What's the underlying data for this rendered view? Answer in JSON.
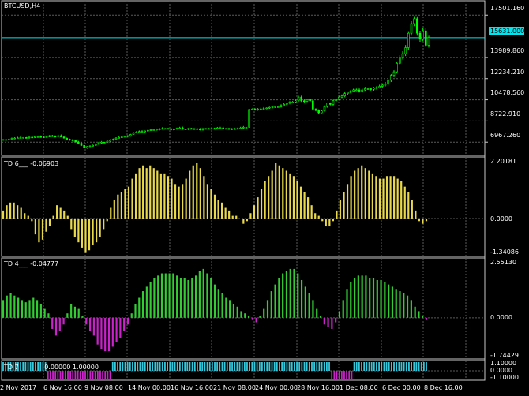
{
  "symbol_title": "BTCUSD,H4",
  "current_price": "15631.000",
  "price_axis": [
    "17501.160",
    "15631.000",
    "13989.860",
    "12234.210",
    "10478.560",
    "8722.910",
    "6967.260"
  ],
  "panels": [
    {
      "name": "TD 6",
      "value": "-0.06903",
      "axis": [
        "2.20181",
        "0.0000",
        "-1.34086"
      ]
    },
    {
      "name": "TD 4",
      "value": "-0.04777",
      "axis": [
        "2.55130",
        "0.0000",
        "-1.74429"
      ]
    },
    {
      "name": "TD 7",
      "values": "0.00000 1.00000",
      "axis": [
        "1.10000",
        "0.0000",
        "-1.10000"
      ]
    }
  ],
  "time_axis": [
    "2 Nov 2017",
    "6 Nov 16:00",
    "9 Nov 08:00",
    "14 Nov 00:00",
    "16 Nov 16:00",
    "21 Nov 08:00",
    "24 Nov 00:00",
    "28 Nov 16:00",
    "1 Dec 08:00",
    "6 Dec 00:00",
    "8 Dec 16:00"
  ],
  "colors": {
    "background": "#000000",
    "grid": "#5a5a5a",
    "bull": "#00ff00",
    "bear": "#00ff00",
    "price_line": "#00e5ee",
    "hist_yellow": "#e8d84a",
    "hist_green": "#33cc33",
    "hist_magenta": "#cc22cc",
    "td7_cyan": "#33c8dc",
    "td7_magenta": "#cc22cc"
  },
  "chart_data": {
    "type": "candlestick",
    "price_last": 15631.0,
    "ylim": [
      6000,
      18500
    ],
    "close_series": [
      7180,
      7180,
      7200,
      7280,
      7300,
      7320,
      7350,
      7350,
      7330,
      7380,
      7350,
      7420,
      7420,
      7400,
      7380,
      7420,
      7500,
      7450,
      7430,
      7500,
      7400,
      7300,
      7200,
      7150,
      7100,
      6980,
      6880,
      6700,
      6500,
      6600,
      6650,
      6700,
      6800,
      6900,
      6960,
      6950,
      7050,
      7150,
      7200,
      7300,
      7350,
      7400,
      7450,
      7500,
      7600,
      7750,
      7800,
      7850,
      7850,
      7900,
      7950,
      8000,
      8000,
      8020,
      8050,
      8100,
      8100,
      8080,
      8000,
      8050,
      8100,
      8150,
      8050,
      8050,
      8100,
      8050,
      8080,
      8050,
      8000,
      8050,
      8100,
      8080,
      8100,
      8100,
      8150,
      8150,
      8100,
      8100,
      8050,
      8080,
      8080,
      8100,
      8150,
      8200,
      8200,
      9680,
      9700,
      9650,
      9700,
      9720,
      9750,
      9800,
      9850,
      9900,
      9900,
      9900,
      10000,
      10100,
      10200,
      10300,
      10300,
      10400,
      10700,
      10400,
      10350,
      10500,
      10400,
      9700,
      9600,
      9400,
      9550,
      9900,
      10200,
      10100,
      10400,
      10500,
      10700,
      10800,
      11000,
      11100,
      11200,
      11300,
      11300,
      11200,
      11300,
      11400,
      11400,
      11350,
      11450,
      11500,
      11600,
      11700,
      11800,
      12100,
      12500,
      12800,
      13500,
      14000,
      14300,
      14800,
      16000,
      16800,
      17200,
      16000,
      15500,
      16200,
      15000,
      15631
    ],
    "td6_hist": [
      0.3,
      0.5,
      0.6,
      0.6,
      0.5,
      0.4,
      0.2,
      0.1,
      -0.1,
      -0.6,
      -0.9,
      -0.8,
      -0.5,
      -0.3,
      0.1,
      0.5,
      0.4,
      0.3,
      0.1,
      -0.4,
      -0.7,
      -0.9,
      -1.1,
      -1.3,
      -1.2,
      -1.0,
      -0.9,
      -0.7,
      -0.4,
      -0.1,
      0.4,
      0.7,
      0.9,
      1.0,
      1.1,
      1.2,
      1.5,
      1.7,
      1.9,
      2.0,
      1.9,
      2.0,
      1.9,
      1.8,
      1.7,
      1.7,
      1.6,
      1.5,
      1.3,
      1.2,
      1.3,
      1.5,
      1.8,
      2.0,
      2.1,
      1.9,
      1.6,
      1.3,
      1.1,
      0.9,
      0.7,
      0.6,
      0.4,
      0.3,
      0.1,
      0.1,
      0.0,
      -0.2,
      -0.1,
      0.2,
      0.5,
      0.8,
      1.1,
      1.4,
      1.6,
      1.8,
      2.1,
      2.0,
      1.9,
      1.8,
      1.7,
      1.6,
      1.4,
      1.2,
      1.0,
      0.8,
      0.5,
      0.2,
      0.1,
      -0.1,
      -0.3,
      -0.3,
      -0.1,
      0.3,
      0.7,
      1.0,
      1.3,
      1.6,
      1.8,
      1.9,
      2.0,
      1.9,
      1.8,
      1.7,
      1.6,
      1.5,
      1.5,
      1.6,
      1.6,
      1.6,
      1.5,
      1.4,
      1.2,
      1.0,
      0.7,
      0.3,
      -0.1,
      -0.2,
      -0.1
    ],
    "td4_hist": [
      0.8,
      1.0,
      1.1,
      1.0,
      0.9,
      0.8,
      0.7,
      0.8,
      0.9,
      0.8,
      0.6,
      0.4,
      0.2,
      -0.5,
      -0.8,
      -0.6,
      -0.3,
      0.2,
      0.6,
      0.5,
      0.4,
      0.1,
      -0.3,
      -0.6,
      -0.8,
      -1.2,
      -1.4,
      -1.5,
      -1.5,
      -1.3,
      -1.1,
      -0.9,
      -0.6,
      -0.3,
      0.2,
      0.6,
      0.9,
      1.2,
      1.4,
      1.6,
      1.8,
      1.9,
      2.0,
      2.0,
      2.0,
      2.0,
      1.9,
      1.8,
      1.8,
      1.7,
      1.8,
      1.9,
      2.1,
      2.2,
      2.0,
      1.8,
      1.5,
      1.3,
      1.1,
      0.9,
      0.8,
      0.6,
      0.5,
      0.3,
      0.2,
      0.1,
      -0.1,
      -0.2,
      0.1,
      0.4,
      0.8,
      1.2,
      1.5,
      1.8,
      2.0,
      2.1,
      2.2,
      2.2,
      2.0,
      1.7,
      1.4,
      1.1,
      0.8,
      0.4,
      0.1,
      -0.3,
      -0.4,
      -0.5,
      -0.2,
      0.3,
      0.8,
      1.3,
      1.6,
      1.8,
      1.9,
      1.9,
      1.9,
      1.8,
      1.8,
      1.7,
      1.7,
      1.6,
      1.5,
      1.4,
      1.3,
      1.2,
      1.1,
      1.0,
      0.8,
      0.5,
      0.3,
      0.1,
      -0.1
    ],
    "td7_bars": [
      1,
      1,
      1,
      1,
      1,
      1,
      1,
      1,
      1,
      1,
      1,
      1,
      1,
      1,
      1,
      1,
      1,
      1,
      0,
      0,
      0,
      0,
      0,
      0,
      0,
      0,
      0,
      0,
      0,
      0,
      0,
      0,
      0,
      0,
      0,
      0,
      0,
      0,
      0,
      0,
      0,
      0,
      0,
      0,
      1,
      1,
      1,
      1,
      1,
      1,
      1,
      1,
      1,
      1,
      1,
      1,
      1,
      1,
      1,
      1,
      1,
      1,
      1,
      1,
      1,
      1,
      1,
      1,
      1,
      1,
      1,
      1,
      1,
      1,
      1,
      1,
      1,
      1,
      1,
      1,
      1,
      1,
      1,
      1,
      1,
      1,
      1,
      1,
      1,
      1,
      1,
      1,
      1,
      1,
      1,
      1,
      1,
      1,
      1,
      1,
      1,
      1,
      1,
      1,
      1,
      1,
      1,
      1,
      1,
      1,
      1,
      1,
      1,
      1,
      1,
      1,
      1,
      1,
      1,
      1,
      1,
      1,
      1,
      1,
      1,
      1,
      1,
      1,
      1,
      1,
      1,
      1,
      0,
      0,
      0,
      0,
      0,
      0,
      0,
      0,
      0,
      1,
      1,
      1,
      1,
      1,
      1,
      1,
      1,
      1,
      1,
      1,
      1,
      1,
      1,
      1,
      1,
      1,
      1,
      1,
      1,
      1,
      1,
      1,
      1,
      1,
      1,
      1,
      1,
      1,
      1
    ]
  }
}
